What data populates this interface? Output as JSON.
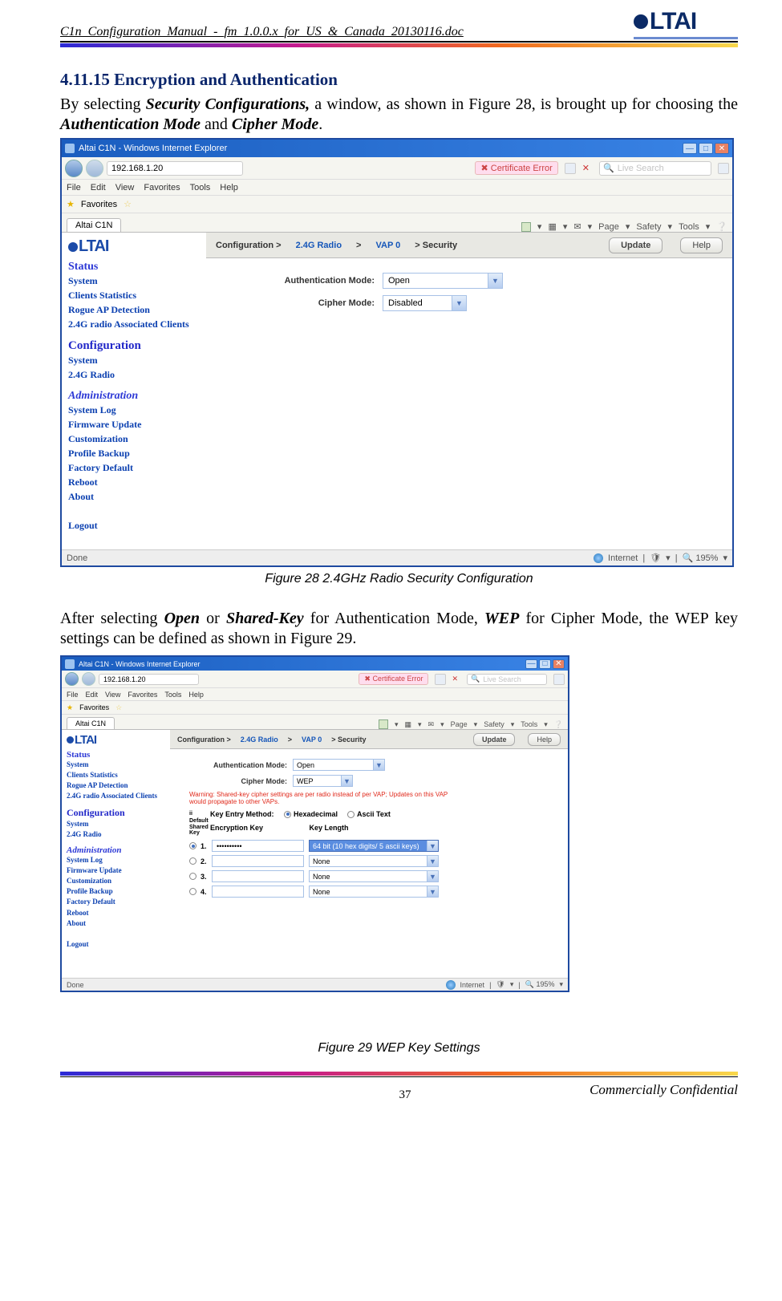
{
  "header": {
    "doc_title": "C1n_Configuration_Manual_-_fm_1.0.0.x_for_US_&_Canada_20130116.doc",
    "brand_text": "LTAI"
  },
  "section": {
    "heading": "4.11.15  Encryption and Authentication",
    "para_a1": "By  selecting  ",
    "para_a2": "Security  Configurations,",
    "para_a3": "  a  window,  as  shown  in  Figure  28,  is  brought  up  for choosing the ",
    "para_a4": "Authentication Mode",
    "para_a5": " and ",
    "para_a6": "Cipher Mode",
    "para_a7": ".",
    "caption1": "Figure 28    2.4GHz Radio Security Configuration",
    "para_b1": "After selecting ",
    "para_b2": "Open",
    "para_b3": " or ",
    "para_b4": "Shared-Key",
    "para_b5": " for Authentication Mode, ",
    "para_b6": "WEP",
    "para_b7": " for Cipher Mode, the WEP key settings can be defined as shown in Figure 29.",
    "caption2": "Figure 29    WEP Key Settings"
  },
  "footer": {
    "page": "37",
    "confidential": "Commercially Confidential"
  },
  "ie": {
    "title": "Altai C1N - Windows Internet Explorer",
    "address": "192.168.1.20",
    "cert": "Certificate Error",
    "search_ph": "Live Search",
    "menu": [
      "File",
      "Edit",
      "View",
      "Favorites",
      "Tools",
      "Help"
    ],
    "fav_label": "Favorites",
    "tab": "Altai C1N",
    "toolbar_items": [
      "Page",
      "Safety",
      "Tools"
    ],
    "status_done": "Done",
    "status_net": "Internet",
    "status_zoom": "195%"
  },
  "app": {
    "brand": "LTAI",
    "crumb": {
      "label": "Configuration >",
      "a1": "2.4G Radio",
      "gt": ">",
      "a2": "VAP 0",
      "tail": "> Security"
    },
    "btn_update": "Update",
    "btn_help": "Help",
    "nav": {
      "status_h": "Status",
      "status": [
        "System",
        "Clients Statistics",
        "Rogue AP Detection",
        "2.4G radio Associated Clients"
      ],
      "config_h": "Configuration",
      "config": [
        "System",
        "2.4G Radio"
      ],
      "admin_h": "Administration",
      "admin": [
        "System Log",
        "Firmware Update",
        "Customization",
        "Profile Backup",
        "Factory Default",
        "Reboot",
        "About"
      ],
      "logout": "Logout"
    },
    "form": {
      "auth_label": "Authentication Mode:",
      "cipher_label": "Cipher Mode:",
      "auth_val_open": "Open",
      "cipher_val_disabled": "Disabled",
      "cipher_val_wep": "WEP"
    },
    "wep": {
      "warning": "Warning: Shared-key cipher settings are per radio instead of per VAP; Updates on this VAP would propagate to other VAPs.",
      "col_default": "Default Shared Key",
      "key_entry": "Key Entry Method:",
      "opt_hex": "Hexadecimal",
      "opt_ascii": "Ascii Text",
      "col_enc": "Encryption Key",
      "col_len": "Key Length",
      "rows": [
        {
          "idx": "1.",
          "val": "••••••••••",
          "len": "64 bit (10 hex digits/ 5 ascii keys)",
          "sel": true
        },
        {
          "idx": "2.",
          "val": "",
          "len": "None",
          "sel": false
        },
        {
          "idx": "3.",
          "val": "",
          "len": "None",
          "sel": false
        },
        {
          "idx": "4.",
          "val": "",
          "len": "None",
          "sel": false
        }
      ]
    }
  }
}
